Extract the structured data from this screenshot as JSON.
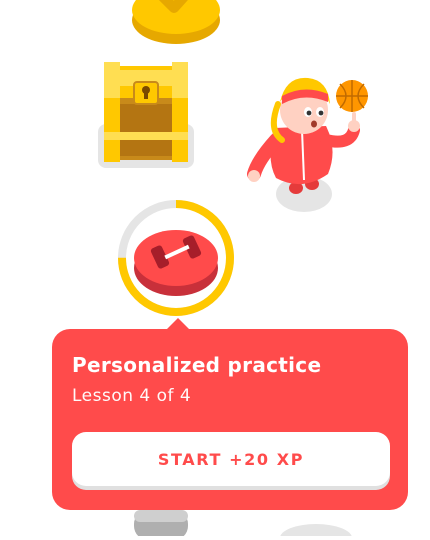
{
  "popup": {
    "title": "Personalized practice",
    "subtitle": "Lesson 4 of 4",
    "start_button_label": "START +20 XP"
  },
  "lesson_node": {
    "icon": "dumbbell-icon",
    "progress_fraction": 0.75
  },
  "icons": {
    "completed_node": "checkmark-icon",
    "chest": "treasure-chest-icon",
    "character": "character-with-basketball"
  },
  "colors": {
    "accent_red": "#ff4b4b",
    "gold": "#ffc800",
    "ring_track": "#e5e5e5",
    "white": "#ffffff"
  }
}
